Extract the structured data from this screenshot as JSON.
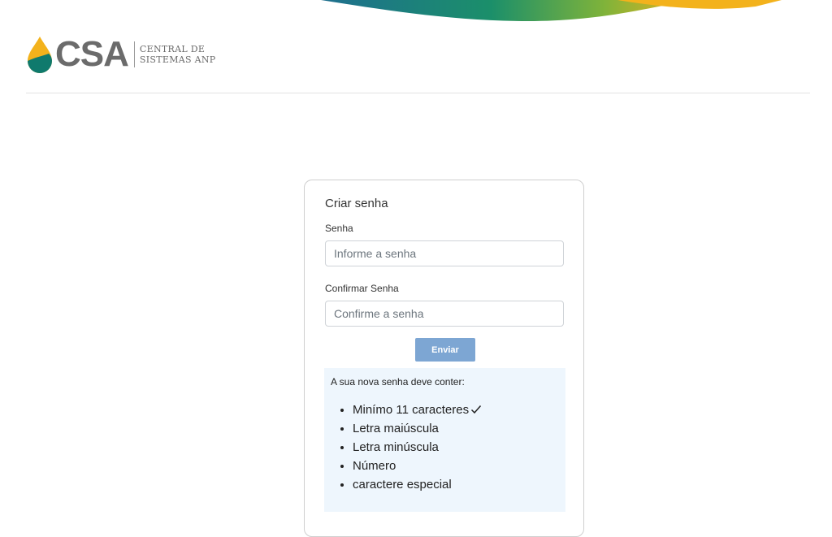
{
  "logo": {
    "text": "CSA",
    "subtitle_line1": "CENTRAL DE",
    "subtitle_line2": "SISTEMAS ANP"
  },
  "colors": {
    "accent": "#7da6d3",
    "drop_yellow": "#f3b21c",
    "drop_teal": "#0f7a6d",
    "panel_bg": "#eef6fd"
  },
  "form": {
    "title": "Criar senha",
    "password": {
      "label": "Senha",
      "placeholder": "Informe a senha",
      "value": ""
    },
    "confirm_password": {
      "label": "Confirmar Senha",
      "placeholder": "Confirme a senha",
      "value": ""
    },
    "submit_label": "Enviar"
  },
  "requirements": {
    "heading": "A sua nova senha deve conter:",
    "items": [
      {
        "label": "Minímo 11 caracteres",
        "met": true,
        "icon": "check-icon"
      },
      {
        "label": "Letra maiúscula",
        "met": false
      },
      {
        "label": "Letra minúscula",
        "met": false
      },
      {
        "label": "Número",
        "met": false
      },
      {
        "label": "caractere especial",
        "met": false
      }
    ]
  }
}
